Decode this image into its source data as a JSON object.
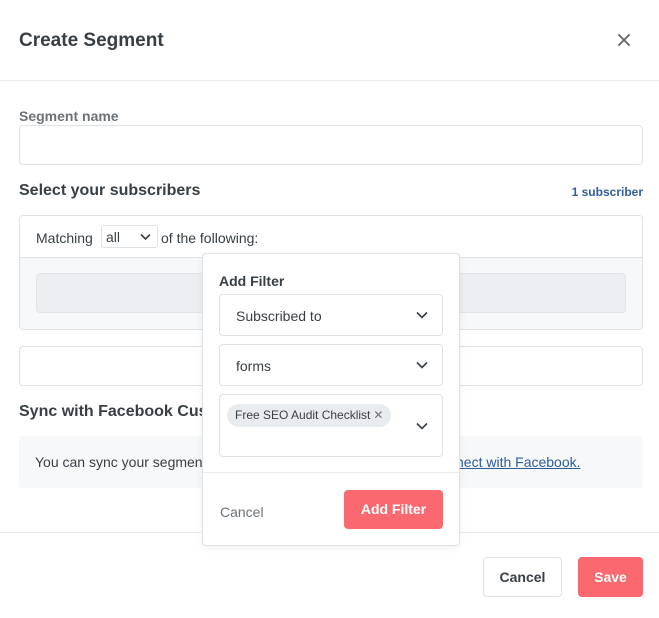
{
  "modal": {
    "title": "Create Segment"
  },
  "segment_name": {
    "label": "Segment name",
    "value": "",
    "placeholder": ""
  },
  "subscribers": {
    "title": "Select your subscribers",
    "count": "1 subscriber",
    "matching_prefix": "Matching",
    "matching_value": "all",
    "matching_suffix": "of the following:"
  },
  "facebook": {
    "title": "Sync with Facebook Cus",
    "text": "You can sync your segmen",
    "link": "nect with Facebook."
  },
  "footer": {
    "cancel_label": "Cancel",
    "save_label": "Save"
  },
  "add_filter": {
    "title": "Add Filter",
    "condition": "Subscribed to",
    "type": "forms",
    "selected_tags": [
      "Free SEO Audit Checklist"
    ],
    "cancel_label": "Cancel",
    "submit_label": "Add Filter"
  },
  "colors": {
    "accent": "#fb6970",
    "link": "#2f5d9a"
  }
}
